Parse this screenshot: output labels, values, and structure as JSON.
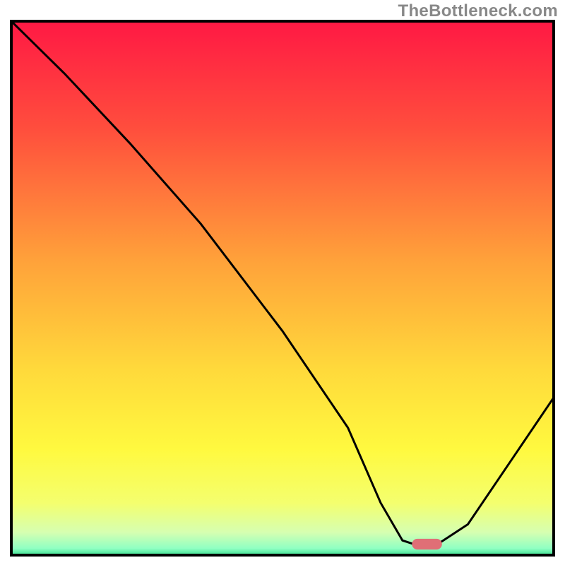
{
  "watermark": "TheBottleneck.com",
  "chart_data": {
    "type": "line",
    "title": "",
    "xlabel": "",
    "ylabel": "",
    "xlim": [
      0,
      100
    ],
    "ylim": [
      0,
      100
    ],
    "gradient_stops": [
      {
        "offset": 0,
        "color": "#ff1844"
      },
      {
        "offset": 0.2,
        "color": "#ff4d3d"
      },
      {
        "offset": 0.45,
        "color": "#ffa23a"
      },
      {
        "offset": 0.65,
        "color": "#ffd93b"
      },
      {
        "offset": 0.8,
        "color": "#fff93f"
      },
      {
        "offset": 0.9,
        "color": "#f4ff6e"
      },
      {
        "offset": 0.955,
        "color": "#d6ffb1"
      },
      {
        "offset": 0.985,
        "color": "#8fffc3"
      },
      {
        "offset": 1.0,
        "color": "#2bd987"
      }
    ],
    "series": [
      {
        "name": "bottleneck-curve",
        "x": [
          0,
          10,
          22,
          35,
          50,
          62,
          68,
          72,
          75,
          78,
          84,
          92,
          100
        ],
        "values": [
          100,
          90,
          77,
          62,
          42,
          24,
          10,
          3,
          2,
          2,
          6,
          18,
          30
        ]
      }
    ],
    "marker": {
      "name": "target-pill",
      "x": 76.5,
      "y": 2.3,
      "color": "#e06f76",
      "width": 5.5,
      "height": 2.0
    }
  }
}
